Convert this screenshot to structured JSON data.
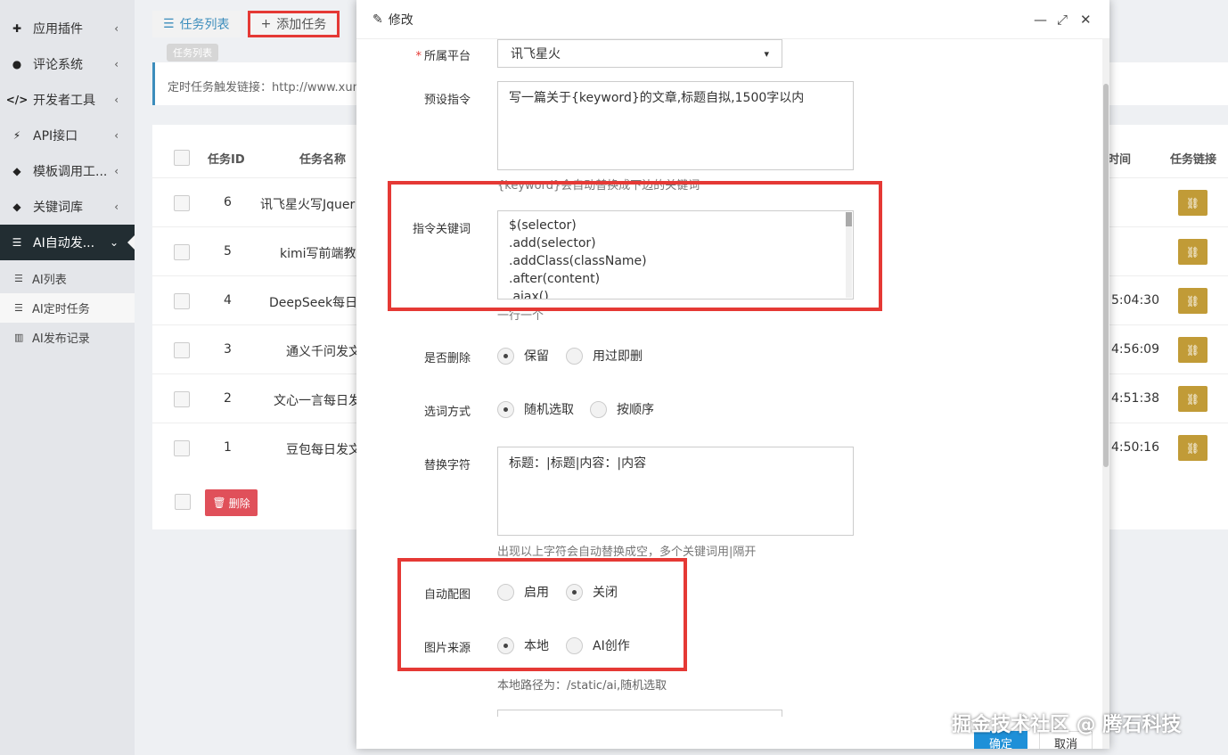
{
  "sidebar": {
    "items": [
      {
        "label": "应用插件"
      },
      {
        "label": "评论系统"
      },
      {
        "label": "开发者工具"
      },
      {
        "label": "API接口"
      },
      {
        "label": "模板调用工..."
      },
      {
        "label": "关键词库"
      },
      {
        "label": "AI自动发..."
      }
    ],
    "sub_items": [
      {
        "label": "AI列表"
      },
      {
        "label": "AI定时任务"
      },
      {
        "label": "AI发布记录"
      }
    ]
  },
  "tabs": {
    "list_label": "任务列表",
    "add_label": "添加任务",
    "tooltip": "任务列表"
  },
  "notice": "定时任务触发链接：http://www.xun",
  "table": {
    "headers": {
      "id": "任务ID",
      "name": "任务名称",
      "time": "时间",
      "link": "任务链接"
    },
    "rows": [
      {
        "id": "6",
        "name": "讯飞星火写Jquer",
        "time": ""
      },
      {
        "id": "5",
        "name": "kimi写前端教",
        "time": ""
      },
      {
        "id": "4",
        "name": "DeepSeek每日发",
        "time": "5:04:30"
      },
      {
        "id": "3",
        "name": "通义千问发文",
        "time": "4:56:09"
      },
      {
        "id": "2",
        "name": "文心一言每日发",
        "time": "4:51:38"
      },
      {
        "id": "1",
        "name": "豆包每日发文",
        "time": "4:50:16"
      }
    ],
    "delete_label": "删除"
  },
  "modal": {
    "title": "修改",
    "platform_label": "所属平台",
    "platform_value": "讯飞星火",
    "prompt_label": "预设指令",
    "prompt_value": "写一篇关于{keyword}的文章,标题自拟,1500字以内",
    "prompt_help": "{keyword}会自动替换成下边的关键词",
    "keywords_label": "指令关键词",
    "keywords_value": "$(selector)\n.add(selector)\n.addClass(className)\n.after(content)\n.ajax()",
    "keywords_help": "一行一个",
    "delete_label": "是否删除",
    "delete_options": [
      "保留",
      "用过即删"
    ],
    "pick_label": "选词方式",
    "pick_options": [
      "随机选取",
      "按顺序"
    ],
    "replace_label": "替换字符",
    "replace_value": "标题：|标题|内容：|内容",
    "replace_help": "出现以上字符会自动替换成空，多个关键词用|隔开",
    "autoimg_label": "自动配图",
    "autoimg_options": [
      "启用",
      "关闭"
    ],
    "imgsrc_label": "图片来源",
    "imgsrc_options": [
      "本地",
      "AI创作"
    ],
    "imgsrc_help": "本地路径为：/static/ai,随机选取",
    "ok_label": "确定",
    "cancel_label": "取消"
  },
  "watermark": "掘金技术社区 @ 腾石科技",
  "colors": {
    "accent": "#3c8dbc",
    "highlight": "#e53935",
    "link_button": "#c19b37",
    "danger": "#e0505a",
    "sidebar_active": "#222d32"
  }
}
